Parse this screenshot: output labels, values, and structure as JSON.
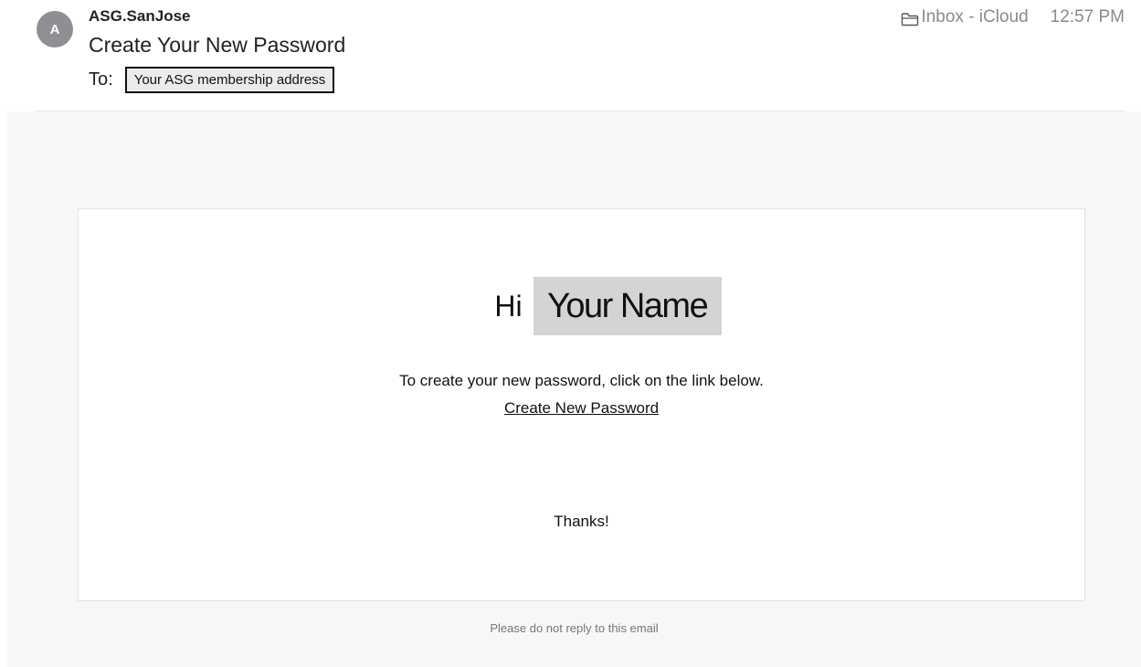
{
  "header": {
    "avatar_initial": "A",
    "sender": "ASG.SanJose",
    "subject": "Create Your New Password",
    "to_label": "To:",
    "to_address": "Your ASG membership address",
    "mailbox": "Inbox - iCloud",
    "time": "12:57 PM",
    "mailbox_icon": "folder-icon"
  },
  "message": {
    "greeting": "Hi",
    "name_placeholder": "Your Name",
    "instruction": "To create your new password, click on the link below.",
    "link_text": "Create New Password",
    "closing": "Thanks!",
    "footer": "Please do not reply to this email"
  }
}
